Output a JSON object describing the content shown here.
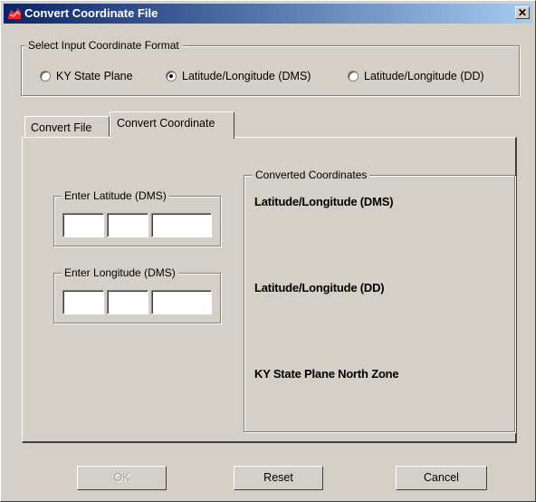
{
  "window": {
    "title": "Convert Coordinate File",
    "close_label": "✕"
  },
  "input_format": {
    "label": "Select Input Coordinate Format",
    "options": [
      {
        "label": "KY State Plane",
        "selected": false
      },
      {
        "label": "Latitude/Longitude (DMS)",
        "selected": true
      },
      {
        "label": "Latitude/Longitude (DD)",
        "selected": false
      }
    ]
  },
  "tabs": [
    {
      "label": "Convert File",
      "active": false
    },
    {
      "label": "Convert Coordinate",
      "active": true
    }
  ],
  "latitude": {
    "label": "Enter Latitude (DMS)",
    "degrees": "",
    "minutes": "",
    "seconds": ""
  },
  "longitude": {
    "label": "Enter Longitude (DMS)",
    "degrees": "",
    "minutes": "",
    "seconds": ""
  },
  "converted": {
    "label": "Converted Coordinates",
    "dms_label": "Latitude/Longitude (DMS)",
    "dd_label": "Latitude/Longitude (DD)",
    "ky_label": "KY State Plane North Zone"
  },
  "buttons": {
    "ok": "OK",
    "reset": "Reset",
    "cancel": "Cancel"
  },
  "colors": {
    "titlebar_start": "#0a246a",
    "titlebar_end": "#a6caf0",
    "face": "#d4d0c8"
  }
}
